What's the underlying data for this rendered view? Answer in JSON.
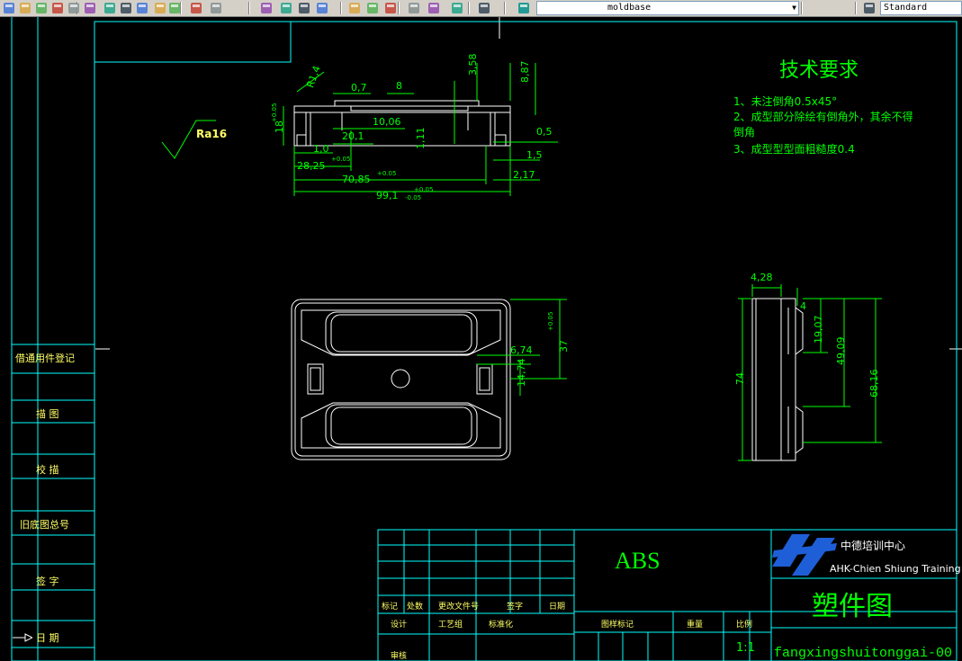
{
  "toolbar": {
    "icons": [
      "new-icon",
      "open-icon",
      "save-icon",
      "print-icon",
      "plot-preview-icon",
      "cut-icon",
      "copy-icon",
      "paste-icon",
      "match-properties-icon",
      "block-editor-icon",
      "undo-icon",
      "redo-icon",
      "pan-icon",
      "zoom-realtime-icon",
      "zoom-window-icon",
      "zoom-previous-icon",
      "properties-icon",
      "design-center-icon",
      "tool-palettes-icon",
      "sheet-set-icon",
      "markup-icon",
      "quickcalc-icon",
      "help-icon",
      "layer-manager-icon",
      "light-bulb-icon",
      "sun-icon",
      "freeze-icon",
      "lock-icon",
      "color-icon",
      "layer-previous-icon",
      "layer-state-icon",
      "text-style-icon"
    ],
    "layer_name": "moldbase",
    "text_style": "Standard",
    "colors": {
      "toolbar_bg": "#d4d0c8",
      "canvas_bg": "#000000"
    }
  },
  "drawing": {
    "colors": {
      "outline": "#ffffff",
      "dimension": "#00ff00",
      "frame": "#00ffff"
    },
    "top_view_dims": {
      "r14": "R1,4",
      "d07": "0,7",
      "d8": "8",
      "d358": "3,58",
      "d887": "8,87",
      "d1806": "18",
      "tol_p005": "+0.05",
      "tol_0": "0",
      "d1006": "10,06",
      "d201": "20,1",
      "d111": "1,11",
      "d05": "0,5",
      "d10": "1,0",
      "d2825": "28,25",
      "d15": "1,5",
      "d7085": "70,85",
      "d217": "2,17",
      "d991": "99,1",
      "tol_m005": "-0.05"
    },
    "roughness": "Ra16",
    "tech_req": {
      "title": "技术要求",
      "line1": "1、未注倒角0.5x45°",
      "line2a": "2、成型部分除绘有倒角外，其余不得",
      "line2b": "倒角",
      "line3": "3、成型型型面粗糙度0.4"
    },
    "front_view_dims": {
      "d674": "6,74",
      "d37": "37",
      "d1474": "14,74",
      "tol_p005": "+0.05",
      "tol_0": "0"
    },
    "side_view_dims": {
      "d428": "4,28",
      "d1907": "19,07",
      "d4909": "49,09",
      "d6816": "68,16",
      "d74": "74",
      "d4": "4",
      "tol_p005": "+0.05",
      "tol_0": "0"
    },
    "side_panel": {
      "cell1": "借通用件登记",
      "cell2": "描  图",
      "cell3": "校  描",
      "cell4": "旧底图总号",
      "cell5": "签  字",
      "cell6": "日  期"
    },
    "title_block": {
      "material": "ABS",
      "company_cn": "中德培训中心",
      "company_en": "AHK-Chien Shiung Training Center",
      "drawing_name": "塑件图",
      "file_name": "fangxingshuitonggai-00",
      "scale": "1:1",
      "row_labels1": [
        "标记",
        "处数",
        "更改文件号",
        "签字",
        "日期"
      ],
      "row_labels2": [
        "设计",
        "工艺组",
        "标准化"
      ],
      "check_label": "审核",
      "stage_label": "图样标记",
      "weight_label": "重量",
      "scale_label": "比例"
    }
  }
}
